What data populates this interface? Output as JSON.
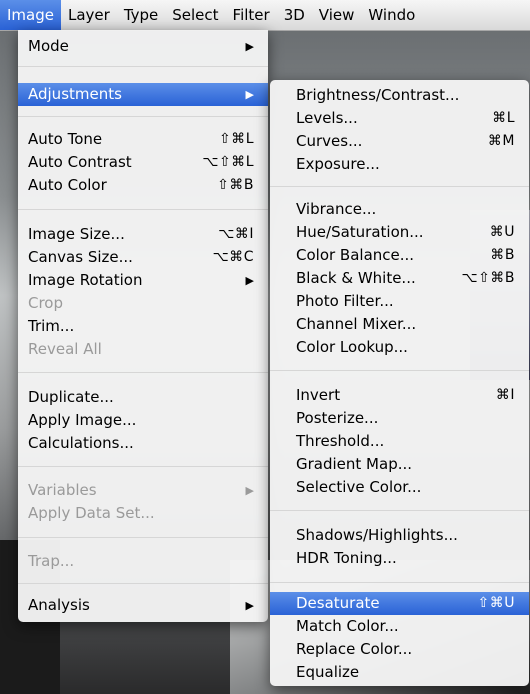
{
  "menubar": {
    "items": [
      "Image",
      "Layer",
      "Type",
      "Select",
      "Filter",
      "3D",
      "View",
      "Windo"
    ]
  },
  "image_menu": {
    "items": [
      {
        "label": "Mode",
        "arrow": true
      },
      {
        "label": "Adjustments",
        "arrow": true,
        "highlighted": true
      },
      {
        "label": "Auto Tone",
        "shortcut": "⇧⌘L"
      },
      {
        "label": "Auto Contrast",
        "shortcut": "⌥⇧⌘L"
      },
      {
        "label": "Auto Color",
        "shortcut": "⇧⌘B"
      },
      {
        "label": "Image Size...",
        "shortcut": "⌥⌘I"
      },
      {
        "label": "Canvas Size...",
        "shortcut": "⌥⌘C"
      },
      {
        "label": "Image Rotation",
        "arrow": true
      },
      {
        "label": "Crop",
        "disabled": true
      },
      {
        "label": "Trim..."
      },
      {
        "label": "Reveal All",
        "disabled": true
      },
      {
        "label": "Duplicate..."
      },
      {
        "label": "Apply Image..."
      },
      {
        "label": "Calculations..."
      },
      {
        "label": "Variables",
        "arrow": true,
        "disabled": true
      },
      {
        "label": "Apply Data Set...",
        "disabled": true
      },
      {
        "label": "Trap...",
        "disabled": true
      },
      {
        "label": "Analysis",
        "arrow": true
      }
    ]
  },
  "adjustments_menu": {
    "items": [
      {
        "label": "Brightness/Contrast..."
      },
      {
        "label": "Levels...",
        "shortcut": "⌘L"
      },
      {
        "label": "Curves...",
        "shortcut": "⌘M"
      },
      {
        "label": "Exposure..."
      },
      {
        "label": "Vibrance..."
      },
      {
        "label": "Hue/Saturation...",
        "shortcut": "⌘U"
      },
      {
        "label": "Color Balance...",
        "shortcut": "⌘B"
      },
      {
        "label": "Black & White...",
        "shortcut": "⌥⇧⌘B"
      },
      {
        "label": "Photo Filter..."
      },
      {
        "label": "Channel Mixer..."
      },
      {
        "label": "Color Lookup..."
      },
      {
        "label": "Invert",
        "shortcut": "⌘I"
      },
      {
        "label": "Posterize..."
      },
      {
        "label": "Threshold..."
      },
      {
        "label": "Gradient Map..."
      },
      {
        "label": "Selective Color..."
      },
      {
        "label": "Shadows/Highlights..."
      },
      {
        "label": "HDR Toning..."
      },
      {
        "label": "Desaturate",
        "shortcut": "⇧⌘U",
        "highlighted": true
      },
      {
        "label": "Match Color..."
      },
      {
        "label": "Replace Color..."
      },
      {
        "label": "Equalize"
      }
    ]
  },
  "arrow_glyph": "▶",
  "colors": {
    "highlight": "#2f68d8",
    "disabled_text": "#9a9a9a"
  }
}
